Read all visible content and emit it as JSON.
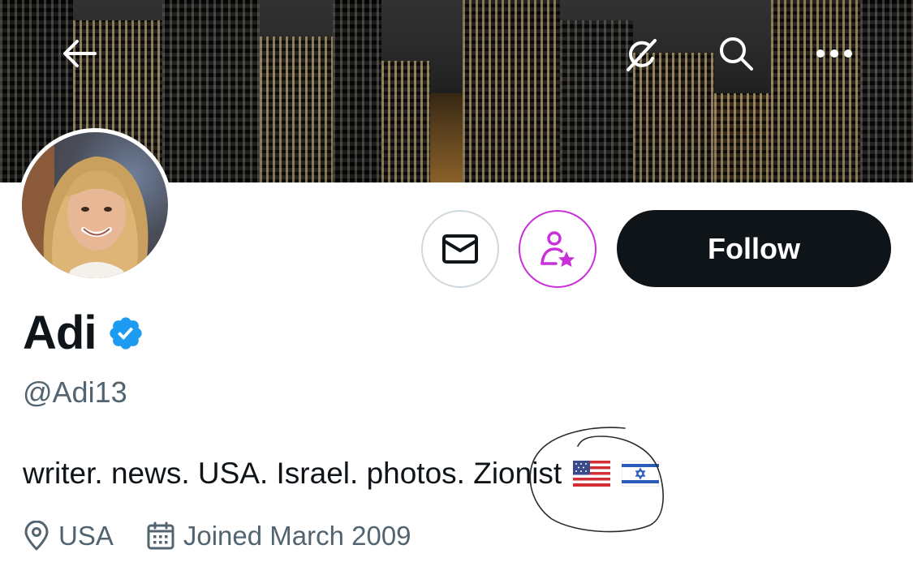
{
  "header": {
    "back_icon": "arrow-left-icon",
    "grok_icon": "grok-icon",
    "search_icon": "search-icon",
    "more_icon": "more-horizontal-icon",
    "banner_image": "night-city-skyline"
  },
  "profile": {
    "display_name": "Adi",
    "verified": true,
    "verified_color": "#1d9bf0",
    "handle": "@Adi13",
    "bio": "writer. news. USA. Israel. photos. Zionist",
    "bio_emojis": [
      "flag-usa-icon",
      "flag-israel-icon"
    ],
    "location": "USA",
    "joined": "Joined March 2009"
  },
  "actions": {
    "message_icon": "envelope-icon",
    "subscribe_icon": "person-star-icon",
    "subscribe_color": "#c930d9",
    "follow_label": "Follow"
  },
  "colors": {
    "text_primary": "#0f1419",
    "text_secondary": "#536471",
    "border": "#cfd9de"
  }
}
